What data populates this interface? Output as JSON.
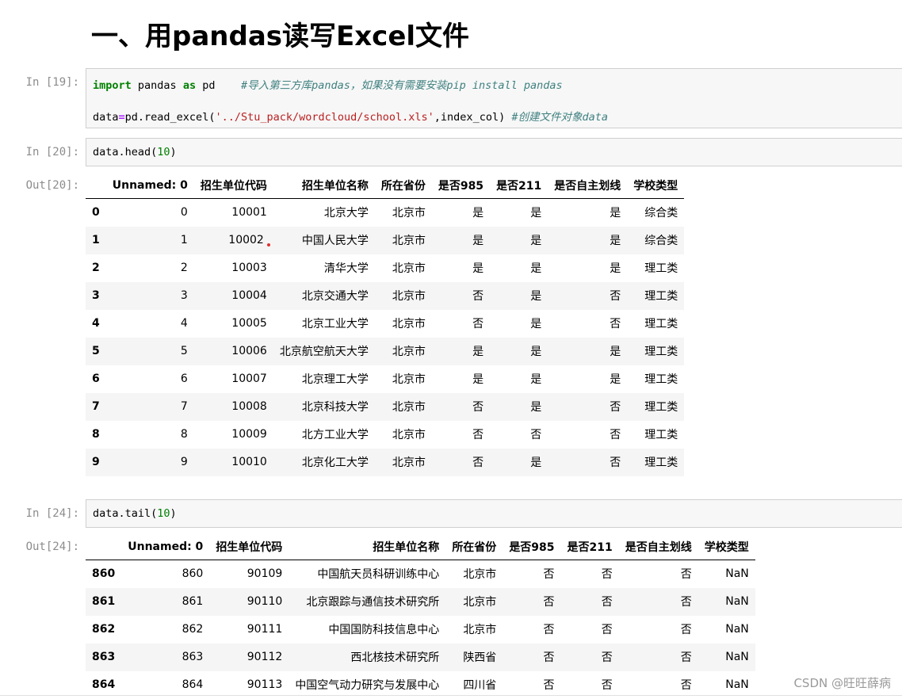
{
  "heading": "一、用pandas读写Excel文件",
  "cells": {
    "in19": {
      "prompt": "In [19]:",
      "line1": {
        "kw1": "import",
        "mod": " pandas ",
        "kw2": "as",
        "alias": " pd    ",
        "comment": "#导入第三方库pandas，如果没有需要安装pip install pandas"
      },
      "line2": {
        "pre": "data",
        "eq": "=",
        "call": "pd.read_excel(",
        "str": "'../Stu_pack/wordcloud/school.xls'",
        "post": ",index_col) ",
        "comment": "#创建文件对象data"
      }
    },
    "in20": {
      "prompt": "In [20]:",
      "pre": "data.head(",
      "num": "10",
      "post": ")"
    },
    "out20": {
      "prompt": "Out[20]:",
      "columns": [
        "",
        "Unnamed: 0",
        "招生单位代码",
        "招生单位名称",
        "所在省份",
        "是否985",
        "是否211",
        "是否自主划线",
        "学校类型"
      ],
      "rows": [
        [
          "0",
          "0",
          "10001",
          "北京大学",
          "北京市",
          "是",
          "是",
          "是",
          "综合类"
        ],
        [
          "1",
          "1",
          "10002",
          "中国人民大学",
          "北京市",
          "是",
          "是",
          "是",
          "综合类"
        ],
        [
          "2",
          "2",
          "10003",
          "清华大学",
          "北京市",
          "是",
          "是",
          "是",
          "理工类"
        ],
        [
          "3",
          "3",
          "10004",
          "北京交通大学",
          "北京市",
          "否",
          "是",
          "否",
          "理工类"
        ],
        [
          "4",
          "4",
          "10005",
          "北京工业大学",
          "北京市",
          "否",
          "是",
          "否",
          "理工类"
        ],
        [
          "5",
          "5",
          "10006",
          "北京航空航天大学",
          "北京市",
          "是",
          "是",
          "是",
          "理工类"
        ],
        [
          "6",
          "6",
          "10007",
          "北京理工大学",
          "北京市",
          "是",
          "是",
          "是",
          "理工类"
        ],
        [
          "7",
          "7",
          "10008",
          "北京科技大学",
          "北京市",
          "否",
          "是",
          "否",
          "理工类"
        ],
        [
          "8",
          "8",
          "10009",
          "北方工业大学",
          "北京市",
          "否",
          "否",
          "否",
          "理工类"
        ],
        [
          "9",
          "9",
          "10010",
          "北京化工大学",
          "北京市",
          "否",
          "是",
          "否",
          "理工类"
        ]
      ]
    },
    "in24": {
      "prompt": "In [24]:",
      "pre": "data.tail(",
      "num": "10",
      "post": ")"
    },
    "out24": {
      "prompt": "Out[24]:",
      "columns": [
        "",
        "Unnamed: 0",
        "招生单位代码",
        "招生单位名称",
        "所在省份",
        "是否985",
        "是否211",
        "是否自主划线",
        "学校类型"
      ],
      "rows": [
        [
          "860",
          "860",
          "90109",
          "中国航天员科研训练中心",
          "北京市",
          "否",
          "否",
          "否",
          "NaN"
        ],
        [
          "861",
          "861",
          "90110",
          "北京跟踪与通信技术研究所",
          "北京市",
          "否",
          "否",
          "否",
          "NaN"
        ],
        [
          "862",
          "862",
          "90111",
          "中国国防科技信息中心",
          "北京市",
          "否",
          "否",
          "否",
          "NaN"
        ],
        [
          "863",
          "863",
          "90112",
          "西北核技术研究所",
          "陕西省",
          "否",
          "否",
          "否",
          "NaN"
        ],
        [
          "864",
          "864",
          "90113",
          "中国空气动力研究与发展中心",
          "四川省",
          "否",
          "否",
          "否",
          "NaN"
        ]
      ]
    }
  },
  "watermark": "CSDN @旺旺薛病"
}
